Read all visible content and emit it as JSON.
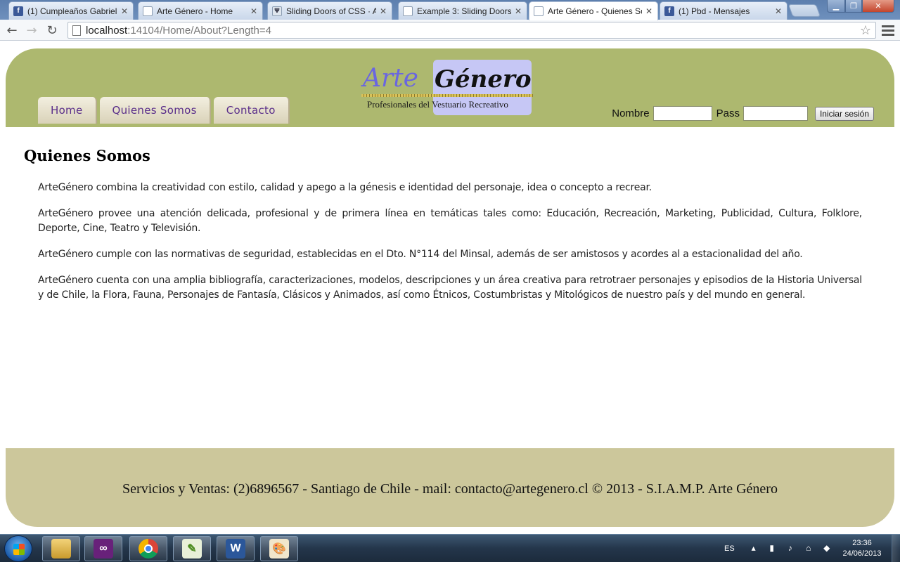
{
  "browser": {
    "tabs": [
      {
        "label": "(1) Cumpleaños Gabriell",
        "icon": "facebook-icon"
      },
      {
        "label": "Arte Género - Home",
        "icon": "page-icon"
      },
      {
        "label": "Sliding Doors of CSS · An",
        "icon": "site-icon"
      },
      {
        "label": "Example 3: Sliding Doors",
        "icon": "page-icon"
      },
      {
        "label": "Arte Género - Quienes So",
        "icon": "page-icon",
        "active": true
      },
      {
        "label": "(1) Pbd - Mensajes",
        "icon": "facebook-icon"
      }
    ],
    "url_host": "localhost",
    "url_path": ":14104/Home/About?Length=4"
  },
  "site": {
    "logo": {
      "arte": "Arte",
      "genero": "Género",
      "tagline": "Profesionales del Vestuario Recreativo"
    },
    "nav": [
      "Home",
      "Quienes Somos",
      "Contacto"
    ],
    "login": {
      "nombre_label": "Nombre",
      "pass_label": "Pass",
      "button": "Iniciar sesión"
    },
    "colors": {
      "header": "#adb86f",
      "footer": "#ccc79b",
      "nav_text": "#5a2e8a"
    }
  },
  "content": {
    "title": "Quienes Somos",
    "paragraphs": [
      "ArteGénero combina la creatividad con estilo, calidad y apego a la génesis e identidad del personaje, idea o concepto a recrear.",
      "ArteGénero provee una atención delicada, profesional y de primera línea en temáticas tales como: Educación, Recreación, Marketing, Publicidad, Cultura, Folklore, Deporte, Cine, Teatro y Televisión.",
      "ArteGénero cumple con las normativas de seguridad, establecidas en el Dto. N°114 del Minsal, además de ser amistosos y acordes al a estacionalidad del año.",
      "ArteGénero cuenta con una amplia bibliografía, caracterizaciones, modelos, descripciones y un área creativa para retrotraer personajes y episodios de la Historia Universal y de Chile, la Flora, Fauna, Personajes de Fantasía, Clásicos y Animados, así como Étnicos, Costumbristas y Mitológicos de nuestro país y del mundo en general."
    ]
  },
  "footer": {
    "text": "Servicios y Ventas: (2)6896567 - Santiago de Chile - mail: contacto@artegenero.cl © 2013 - S.I.A.M.P. Arte Género"
  },
  "taskbar": {
    "apps": [
      "file-explorer-icon",
      "visual-studio-icon",
      "chrome-icon",
      "notepad-plus-icon",
      "word-icon",
      "paint-icon"
    ],
    "language": "ES",
    "time": "23:36",
    "date": "24/06/2013"
  }
}
